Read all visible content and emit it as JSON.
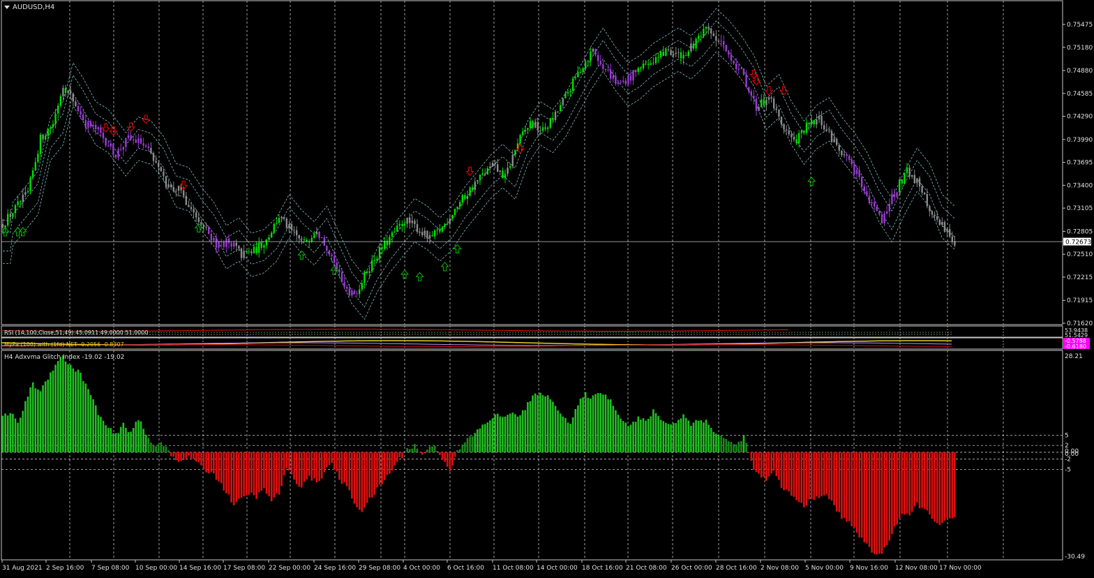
{
  "window": {
    "title": "AUDUSD,H4",
    "menu_arrow_icon": "triangle-down-icon"
  },
  "colors": {
    "background": "#000000",
    "border": "#c8c8c8",
    "grid": "#c8c8c8",
    "bull_candle": "#00e000",
    "bear_candle": "#9b3dd6",
    "neutral_candle": "#8c8c8c",
    "channel_line": "#7fbfbf",
    "up_arrow": "#00b000",
    "down_arrow": "#e00000",
    "hist_pos": "#22c022",
    "hist_pos_dark": "#1a8a1a",
    "hist_neg": "#e01010",
    "price_label_bg": "#ffffff",
    "magenta_label": "#ff00ff"
  },
  "price_axis": {
    "labels": [
      "0.75475",
      "0.75180",
      "0.74880",
      "0.74585",
      "0.74290",
      "0.73990",
      "0.73695",
      "0.73400",
      "0.73105",
      "0.72805",
      "0.72510",
      "0.72215",
      "0.71915",
      "0.71620"
    ],
    "current_price": "0.72673"
  },
  "time_axis": {
    "labels": [
      "31 Aug 2021",
      "2 Sep 16:00",
      "7 Sep 08:00",
      "10 Sep 00:00",
      "14 Sep 16:00",
      "17 Sep 08:00",
      "22 Sep 00:00",
      "24 Sep 16:00",
      "29 Sep 08:00",
      "4 Oct 00:00",
      "6 Oct 16:00",
      "11 Oct 08:00",
      "14 Oct 00:00",
      "18 Oct 16:00",
      "21 Oct 08:00",
      "26 Oct 00:00",
      "28 Oct 16:00",
      "2 Nov 08:00",
      "5 Nov 00:00",
      "9 Nov 16:00",
      "12 Nov 08:00",
      "17 Nov 00:00"
    ]
  },
  "rsi_panel": {
    "title": "RSI (14,100,Close,51,49) 45.0911 49.0000 51.0000",
    "axis_a": "53.9438",
    "axis_b": "51.5429"
  },
  "mypa_panel": {
    "title": "MyPa (100) with (1fd) NET -0.2056 -0.8307",
    "axis_a": "-0.5788",
    "axis_b": "-0.6180"
  },
  "adx_panel": {
    "title": "H4 Adxvma Glitch Index -19.02 -19.02",
    "axis_labels": {
      "max": "28.21",
      "l5": "5",
      "l2": "2",
      "zero_a": "0.00",
      "zero_b": "0.00",
      "ln2": "-2",
      "ln5": "-5",
      "min": "-30.49"
    }
  },
  "chart_data": [
    {
      "type": "candlestick",
      "title": "AUDUSD,H4",
      "ylim": [
        0.7162,
        0.7562
      ],
      "x_labels": [
        "31 Aug 2021",
        "2 Sep 16:00",
        "7 Sep 08:00",
        "10 Sep 00:00",
        "14 Sep 16:00",
        "17 Sep 08:00",
        "22 Sep 00:00",
        "24 Sep 16:00",
        "29 Sep 08:00",
        "4 Oct 00:00",
        "6 Oct 16:00",
        "11 Oct 08:00",
        "14 Oct 00:00",
        "18 Oct 16:00",
        "21 Oct 08:00",
        "26 Oct 00:00",
        "28 Oct 16:00",
        "2 Nov 08:00",
        "5 Nov 00:00",
        "9 Nov 16:00",
        "12 Nov 08:00",
        "17 Nov 00:00"
      ],
      "close_path": [
        [
          0,
          0.729
        ],
        [
          5,
          0.731
        ],
        [
          10,
          0.733
        ],
        [
          15,
          0.74
        ],
        [
          20,
          0.742
        ],
        [
          24,
          0.747
        ],
        [
          28,
          0.745
        ],
        [
          33,
          0.742
        ],
        [
          38,
          0.741
        ],
        [
          45,
          0.738
        ],
        [
          50,
          0.74
        ],
        [
          55,
          0.7395
        ],
        [
          60,
          0.7375
        ],
        [
          65,
          0.734
        ],
        [
          70,
          0.7335
        ],
        [
          75,
          0.731
        ],
        [
          80,
          0.729
        ],
        [
          85,
          0.726
        ],
        [
          90,
          0.727
        ],
        [
          95,
          0.725
        ],
        [
          100,
          0.7255
        ],
        [
          105,
          0.727
        ],
        [
          110,
          0.73
        ],
        [
          115,
          0.728
        ],
        [
          120,
          0.7265
        ],
        [
          125,
          0.7285
        ],
        [
          130,
          0.725
        ],
        [
          135,
          0.7215
        ],
        [
          140,
          0.7195
        ],
        [
          145,
          0.723
        ],
        [
          150,
          0.7255
        ],
        [
          155,
          0.7275
        ],
        [
          160,
          0.7295
        ],
        [
          165,
          0.7285
        ],
        [
          170,
          0.727
        ],
        [
          175,
          0.7285
        ],
        [
          180,
          0.731
        ],
        [
          185,
          0.733
        ],
        [
          190,
          0.735
        ],
        [
          195,
          0.7365
        ],
        [
          200,
          0.735
        ],
        [
          205,
          0.7395
        ],
        [
          210,
          0.742
        ],
        [
          215,
          0.741
        ],
        [
          220,
          0.743
        ],
        [
          225,
          0.746
        ],
        [
          230,
          0.749
        ],
        [
          235,
          0.7515
        ],
        [
          240,
          0.749
        ],
        [
          245,
          0.747
        ],
        [
          250,
          0.748
        ],
        [
          255,
          0.7495
        ],
        [
          260,
          0.7505
        ],
        [
          265,
          0.7515
        ],
        [
          270,
          0.7505
        ],
        [
          275,
          0.752
        ],
        [
          280,
          0.754
        ],
        [
          285,
          0.7525
        ],
        [
          290,
          0.7505
        ],
        [
          295,
          0.748
        ],
        [
          300,
          0.744
        ],
        [
          305,
          0.7455
        ],
        [
          310,
          0.742
        ],
        [
          315,
          0.7395
        ],
        [
          320,
          0.7415
        ],
        [
          325,
          0.7425
        ],
        [
          330,
          0.74
        ],
        [
          335,
          0.738
        ],
        [
          340,
          0.7355
        ],
        [
          345,
          0.732
        ],
        [
          350,
          0.7295
        ],
        [
          355,
          0.733
        ],
        [
          360,
          0.736
        ],
        [
          365,
          0.734
        ],
        [
          370,
          0.73
        ],
        [
          375,
          0.7285
        ],
        [
          379,
          0.7267
        ]
      ],
      "bear_segments": [
        [
          30,
          58
        ],
        [
          82,
          92
        ],
        [
          126,
          141
        ],
        [
          236,
          252
        ],
        [
          286,
          300
        ],
        [
          336,
          356
        ]
      ],
      "channel_offset": 0.0012,
      "channel_outer_offset": 0.0028,
      "up_arrows": [
        [
          1,
          0.728
        ],
        [
          6,
          0.728
        ],
        [
          8,
          0.728
        ],
        [
          78,
          0.7285
        ],
        [
          119,
          0.725
        ],
        [
          132,
          0.723
        ],
        [
          160,
          0.7225
        ],
        [
          166,
          0.7222
        ],
        [
          176,
          0.7235
        ],
        [
          181,
          0.7258
        ],
        [
          322,
          0.7345
        ]
      ],
      "down_arrows": [
        [
          41,
          0.7414
        ],
        [
          44,
          0.741
        ],
        [
          51,
          0.7415
        ],
        [
          57,
          0.7425
        ],
        [
          72,
          0.734
        ],
        [
          186,
          0.7358
        ],
        [
          206,
          0.7387
        ],
        [
          299,
          0.7483
        ],
        [
          300,
          0.7475
        ],
        [
          305,
          0.7462
        ],
        [
          311,
          0.7462
        ]
      ],
      "last_price": 0.72673
    },
    {
      "type": "bar",
      "title": "H4 Adxvma Glitch Index -19.02 -19.02",
      "ylim": [
        -30.49,
        28.21
      ],
      "levels": [
        5,
        2,
        0,
        -2,
        -5
      ],
      "value_path": [
        [
          0,
          10
        ],
        [
          3,
          12
        ],
        [
          6,
          8
        ],
        [
          9,
          15
        ],
        [
          12,
          20
        ],
        [
          15,
          18
        ],
        [
          18,
          22
        ],
        [
          21,
          26
        ],
        [
          24,
          28.2
        ],
        [
          27,
          25
        ],
        [
          30,
          24
        ],
        [
          33,
          20
        ],
        [
          36,
          15
        ],
        [
          39,
          10
        ],
        [
          42,
          7
        ],
        [
          45,
          5
        ],
        [
          48,
          8
        ],
        [
          51,
          6
        ],
        [
          54,
          10
        ],
        [
          57,
          5
        ],
        [
          60,
          2
        ],
        [
          63,
          3
        ],
        [
          66,
          1
        ],
        [
          68,
          -2
        ],
        [
          71,
          -3
        ],
        [
          74,
          -1
        ],
        [
          77,
          -3
        ],
        [
          80,
          -5
        ],
        [
          83,
          -6
        ],
        [
          86,
          -8
        ],
        [
          89,
          -12
        ],
        [
          92,
          -15
        ],
        [
          95,
          -14
        ],
        [
          98,
          -12
        ],
        [
          101,
          -13
        ],
        [
          104,
          -11
        ],
        [
          107,
          -14
        ],
        [
          110,
          -12
        ],
        [
          113,
          -5
        ],
        [
          116,
          -8
        ],
        [
          119,
          -10
        ],
        [
          122,
          -7
        ],
        [
          125,
          -9
        ],
        [
          128,
          -6
        ],
        [
          131,
          -3
        ],
        [
          134,
          -8
        ],
        [
          137,
          -10
        ],
        [
          140,
          -15
        ],
        [
          143,
          -17
        ],
        [
          146,
          -14
        ],
        [
          149,
          -11
        ],
        [
          152,
          -8
        ],
        [
          155,
          -5
        ],
        [
          158,
          -2
        ],
        [
          161,
          1
        ],
        [
          164,
          2
        ],
        [
          167,
          -1
        ],
        [
          170,
          2
        ],
        [
          173,
          1
        ],
        [
          176,
          -3
        ],
        [
          178,
          -5
        ],
        [
          181,
          0
        ],
        [
          184,
          3
        ],
        [
          187,
          5
        ],
        [
          190,
          7
        ],
        [
          193,
          9
        ],
        [
          196,
          11
        ],
        [
          199,
          10
        ],
        [
          202,
          12
        ],
        [
          205,
          10
        ],
        [
          208,
          13
        ],
        [
          211,
          16
        ],
        [
          214,
          18
        ],
        [
          217,
          16
        ],
        [
          220,
          14
        ],
        [
          223,
          11
        ],
        [
          226,
          8
        ],
        [
          229,
          14
        ],
        [
          232,
          17
        ],
        [
          235,
          16
        ],
        [
          238,
          18
        ],
        [
          241,
          16
        ],
        [
          244,
          13
        ],
        [
          247,
          9
        ],
        [
          250,
          8
        ],
        [
          253,
          10
        ],
        [
          256,
          9
        ],
        [
          259,
          12
        ],
        [
          262,
          10
        ],
        [
          265,
          8
        ],
        [
          268,
          9
        ],
        [
          271,
          11
        ],
        [
          274,
          8
        ],
        [
          277,
          10
        ],
        [
          280,
          9
        ],
        [
          283,
          6
        ],
        [
          286,
          5
        ],
        [
          289,
          3
        ],
        [
          292,
          2
        ],
        [
          295,
          5
        ],
        [
          298,
          -3
        ],
        [
          301,
          -7
        ],
        [
          304,
          -8
        ],
        [
          307,
          -6
        ],
        [
          310,
          -10
        ],
        [
          313,
          -12
        ],
        [
          316,
          -14
        ],
        [
          319,
          -16
        ],
        [
          322,
          -13
        ],
        [
          325,
          -14
        ],
        [
          328,
          -12
        ],
        [
          331,
          -16
        ],
        [
          334,
          -19
        ],
        [
          337,
          -20
        ],
        [
          340,
          -24
        ],
        [
          343,
          -26
        ],
        [
          346,
          -29
        ],
        [
          349,
          -30.49
        ],
        [
          352,
          -27
        ],
        [
          355,
          -22
        ],
        [
          358,
          -18
        ],
        [
          361,
          -19
        ],
        [
          364,
          -15
        ],
        [
          367,
          -17
        ],
        [
          370,
          -19
        ],
        [
          373,
          -21
        ],
        [
          376,
          -20
        ],
        [
          379,
          -19.02
        ]
      ]
    }
  ]
}
